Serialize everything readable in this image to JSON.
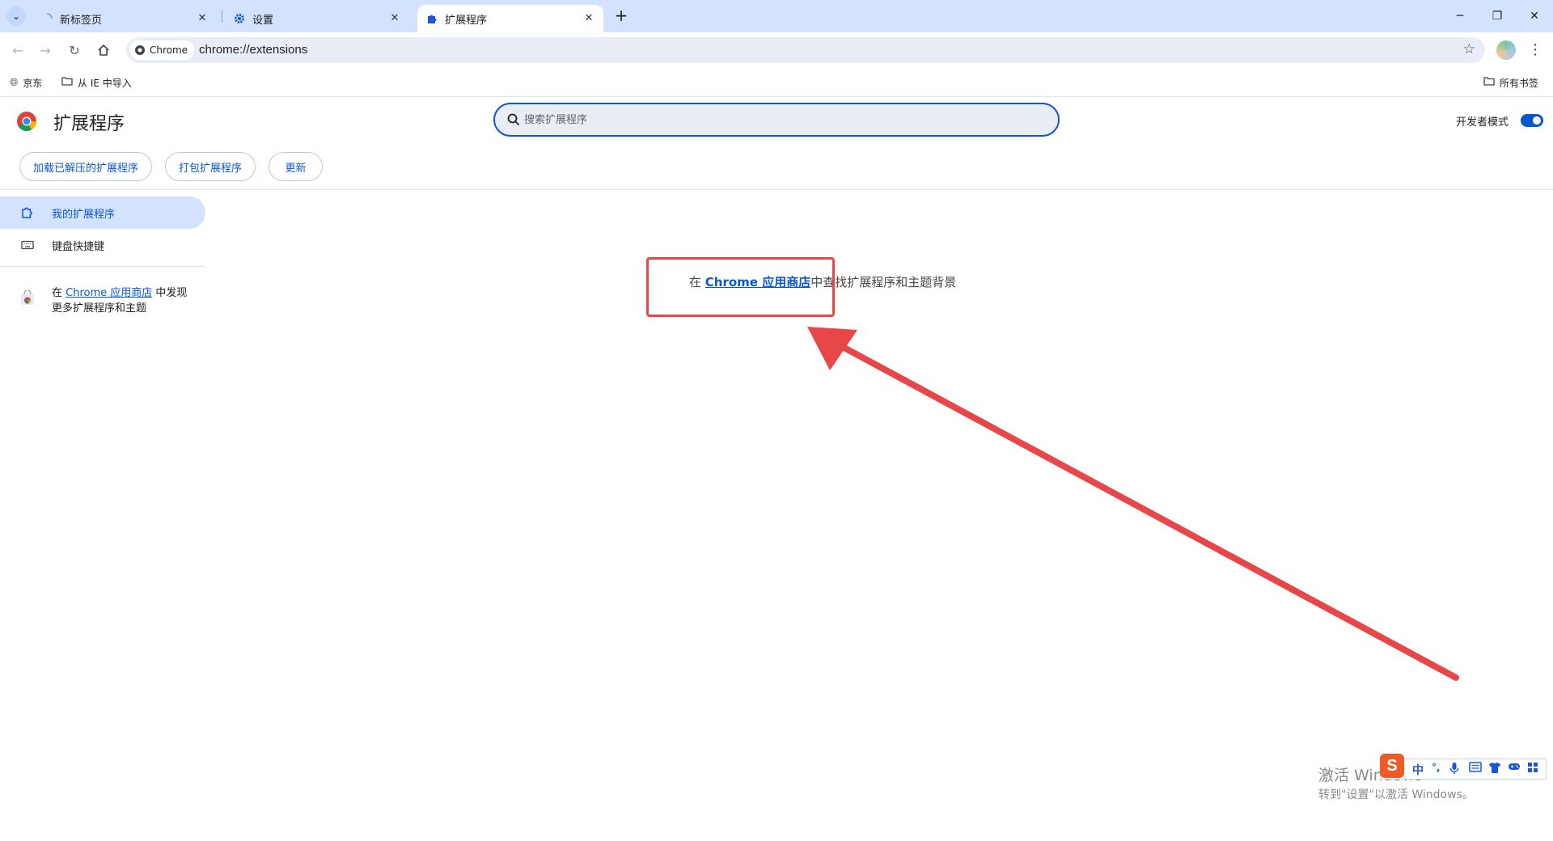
{
  "tabs": [
    {
      "title": "新标签页"
    },
    {
      "title": "设置"
    },
    {
      "title": "扩展程序"
    }
  ],
  "toolbar": {
    "chip_label": "Chrome",
    "url": "chrome://extensions"
  },
  "bookmarks": {
    "items": [
      {
        "label": "京东"
      },
      {
        "label": "从 IE 中导入"
      }
    ],
    "all_bookmarks": "所有书签"
  },
  "header": {
    "title": "扩展程序",
    "search_placeholder": "搜索扩展程序",
    "dev_mode_label": "开发者模式",
    "dev_mode_on": true,
    "buttons": [
      {
        "label": "加载已解压的扩展程序"
      },
      {
        "label": "打包扩展程序"
      },
      {
        "label": "更新"
      }
    ]
  },
  "sidebar": {
    "items": [
      {
        "label": "我的扩展程序",
        "active": true
      },
      {
        "label": "键盘快捷键",
        "active": false
      }
    ],
    "promo_prefix": "在 ",
    "promo_link": "Chrome 应用商店",
    "promo_suffix": " 中发现更多扩展程序和主题"
  },
  "main": {
    "empty_prefix": "在 ",
    "empty_link": "Chrome 应用商店",
    "empty_suffix": "中查找扩展程序和主题背景"
  },
  "watermark": {
    "line1": "激活 Windows",
    "line2": "转到\"设置\"以激活 Windows。"
  },
  "ime": {
    "logo": "S",
    "mode": "中"
  },
  "colors": {
    "accent": "#0b57d0",
    "tabstrip": "#d3e3fd",
    "annotation": "#e8474a"
  }
}
